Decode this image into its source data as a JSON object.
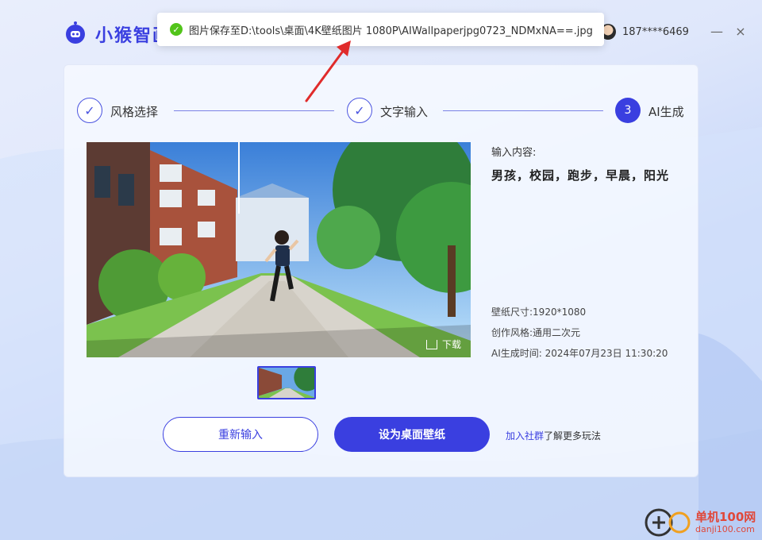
{
  "app": {
    "name": "小猴智画",
    "user_id": "187****6469"
  },
  "window_controls": {
    "minimize": "—",
    "close": "×"
  },
  "toast": {
    "icon": "check-circle-icon",
    "message": "图片保存至D:\\tools\\桌面\\4K壁纸图片 1080P\\AIWallpaperjpg0723_NDMxNA==.jpg"
  },
  "steps": [
    {
      "label": "风格选择",
      "state": "done",
      "marker": "✓"
    },
    {
      "label": "文字输入",
      "state": "done",
      "marker": "✓"
    },
    {
      "label": "AI生成",
      "state": "active",
      "marker": "3"
    }
  ],
  "preview": {
    "download_label": "下载"
  },
  "info": {
    "label": "输入内容:",
    "prompt": "男孩，校园，跑步，早晨，阳光",
    "size": "壁纸尺寸:1920*1080",
    "style": "创作风格:通用二次元",
    "time": "AI生成时间: 2024年07月23日 11:30:20"
  },
  "buttons": {
    "reenter": "重新输入",
    "set_wallpaper": "设为桌面壁纸"
  },
  "community": {
    "link": "加入社群",
    "rest": "了解更多玩法"
  },
  "watermark": {
    "line1": "单机100网",
    "line2": "danji100.com"
  },
  "colors": {
    "accent": "#3a3fe0",
    "success": "#52c41a",
    "arrow": "#e02b2b"
  }
}
